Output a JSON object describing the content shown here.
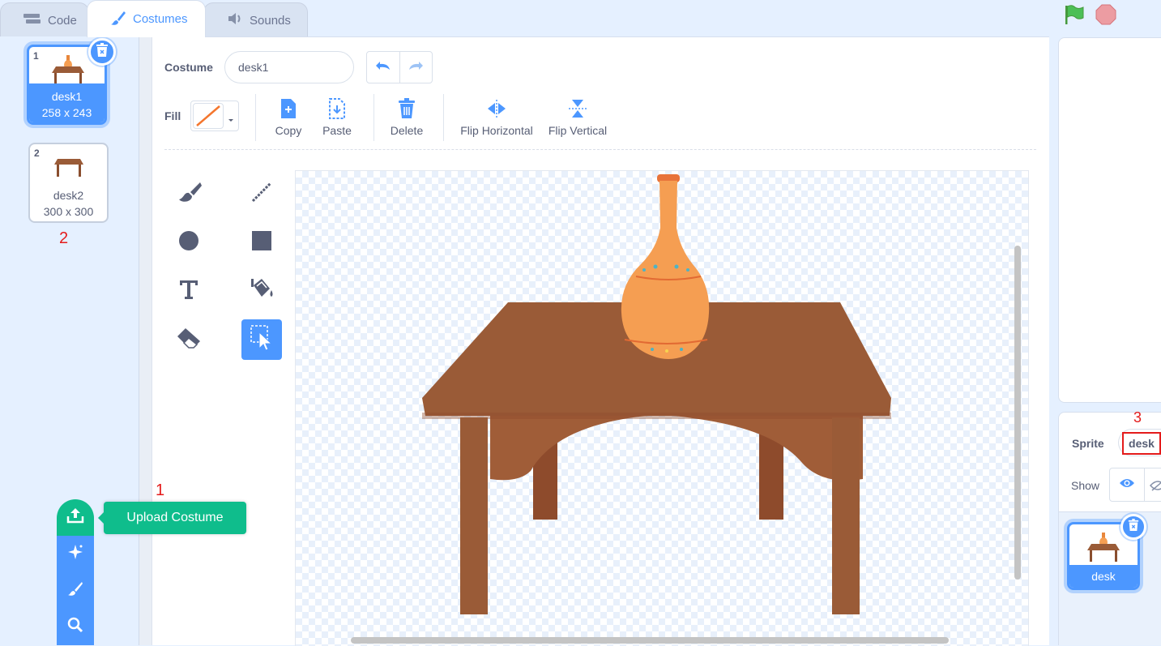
{
  "tabs": [
    {
      "label": "Code",
      "icon": "code-blocks-icon"
    },
    {
      "label": "Costumes",
      "icon": "paintbrush-icon"
    },
    {
      "label": "Sounds",
      "icon": "speaker-icon"
    }
  ],
  "stage_controls": {
    "green_flag": "green-flag-icon",
    "stop": "stop-icon"
  },
  "costumes": [
    {
      "number": "1",
      "name": "desk1",
      "size": "258 x 243",
      "selected": true
    },
    {
      "number": "2",
      "name": "desk2",
      "size": "300 x 300",
      "selected": false
    }
  ],
  "annotations": {
    "upload_marker": "1",
    "list_marker": "2",
    "sprite_marker": "3"
  },
  "editor": {
    "costume_label": "Costume",
    "costume_name": "desk1",
    "fill_label": "Fill",
    "actions": [
      "Copy",
      "Paste",
      "Delete",
      "Flip Horizontal",
      "Flip Vertical"
    ],
    "tools": [
      "brush",
      "line",
      "circle",
      "rectangle",
      "text",
      "fill",
      "eraser",
      "select"
    ],
    "active_tool": "select"
  },
  "add_menu": {
    "tooltip": "Upload Costume",
    "items": [
      "upload-icon",
      "surprise-icon",
      "paint-icon",
      "search-icon"
    ]
  },
  "sprite": {
    "label": "Sprite",
    "name": "desk",
    "show_label": "Show",
    "tile_name": "desk"
  },
  "colors": {
    "accent": "#4c97ff",
    "green": "#0fbd8c",
    "desk": "#9a5b37",
    "vase": "#f59e52"
  }
}
